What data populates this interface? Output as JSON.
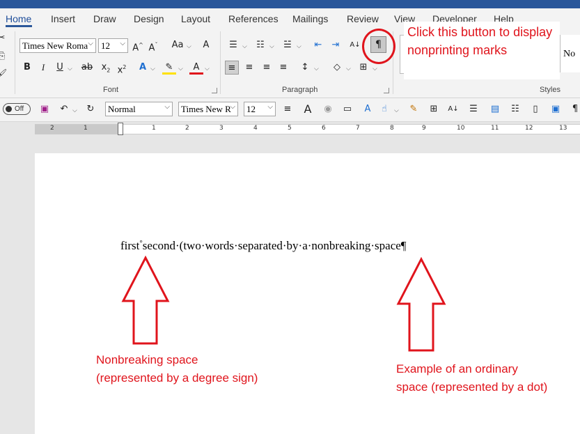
{
  "ribbon_tabs": [
    "Home",
    "Insert",
    "Draw",
    "Design",
    "Layout",
    "References",
    "Mailings",
    "Review",
    "View",
    "Developer",
    "Help"
  ],
  "font_group": {
    "font_name": "Times New Roma",
    "font_size": "12",
    "label": "Font"
  },
  "paragraph_group": {
    "label": "Paragraph"
  },
  "styles_group": {
    "label": "Styles",
    "preview": "No"
  },
  "quick_access": {
    "toggle_label": "Off",
    "style_combo": "Normal",
    "font_combo": "Times New R",
    "size_combo": "12"
  },
  "ruler_numbers": [
    "2",
    "1",
    "1",
    "2",
    "3",
    "4",
    "5",
    "6",
    "7",
    "8",
    "9",
    "10",
    "11",
    "12",
    "13"
  ],
  "document": {
    "word_first": "first",
    "nonbreaking_mark": "°",
    "rest_text": "second·(two·words·separated·by·a·nonbreaking·space¶"
  },
  "annotations": {
    "callout_top": "Click this button to display nonprinting marks",
    "nonbreaking_note": "Nonbreaking space (represented by a degree sign)",
    "ordinary_note": "Example of an ordinary space (represented by a dot)"
  },
  "colors": {
    "annotation_red": "#e0141c",
    "word_blue": "#2b579a"
  }
}
